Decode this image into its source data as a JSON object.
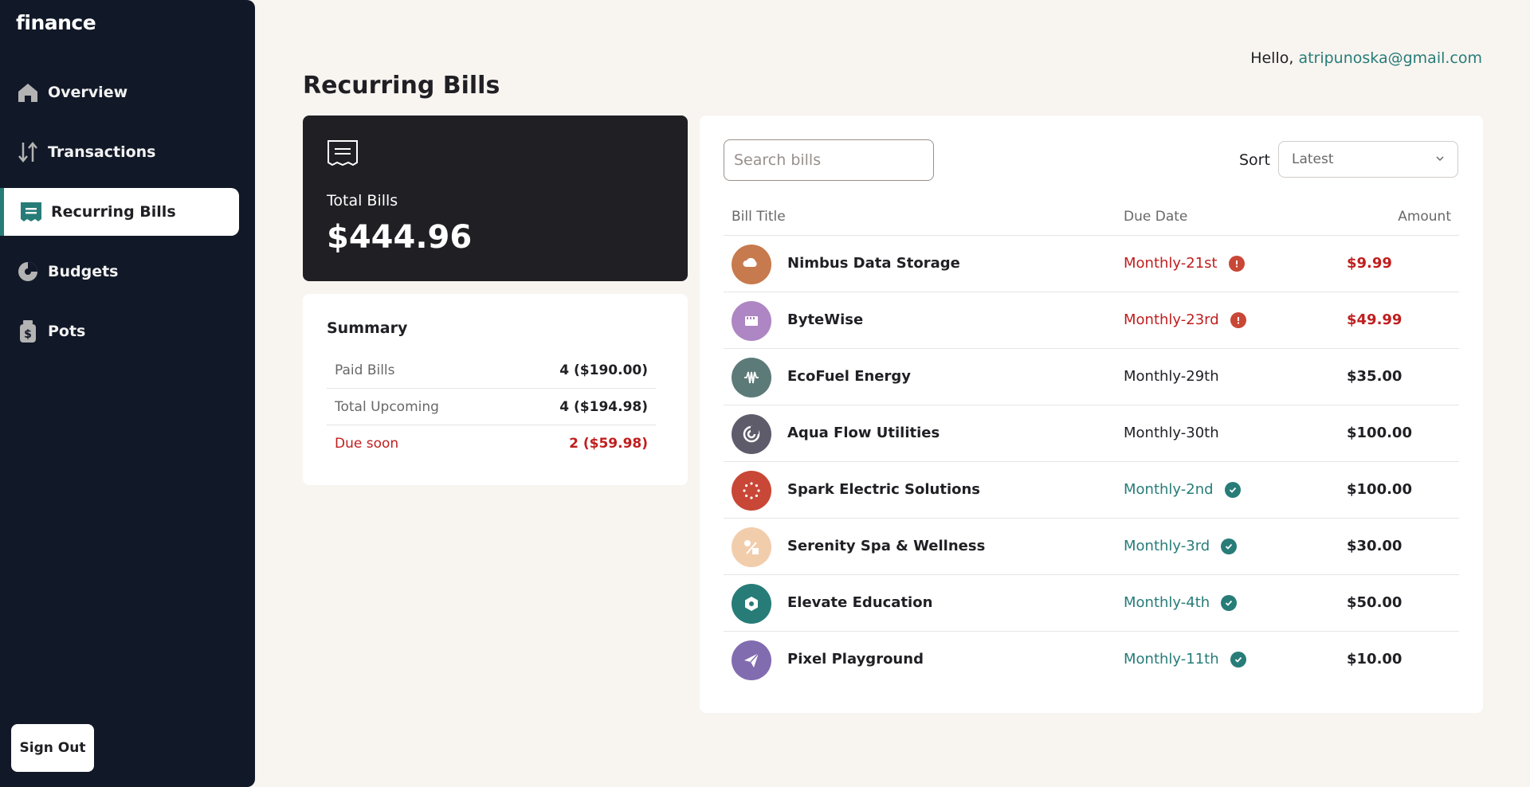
{
  "app": {
    "logo": "finance"
  },
  "nav": {
    "items": [
      {
        "label": "Overview",
        "icon": "home-icon"
      },
      {
        "label": "Transactions",
        "icon": "arrows-updown-icon"
      },
      {
        "label": "Recurring Bills",
        "icon": "receipt-icon",
        "active": true
      },
      {
        "label": "Budgets",
        "icon": "pie-icon"
      },
      {
        "label": "Pots",
        "icon": "jar-icon"
      }
    ],
    "signout": "Sign Out"
  },
  "header": {
    "greeting": "Hello, ",
    "email": "atripunoska@gmail.com"
  },
  "page": {
    "title": "Recurring Bills"
  },
  "total": {
    "label": "Total Bills",
    "value": "$444.96"
  },
  "summary": {
    "title": "Summary",
    "rows": [
      {
        "label": "Paid Bills",
        "value": "4 ($190.00)"
      },
      {
        "label": "Total Upcoming",
        "value": "4 ($194.98)"
      },
      {
        "label": "Due soon",
        "value": "2 ($59.98)"
      }
    ]
  },
  "bills": {
    "search_placeholder": "Search bills",
    "sort_label": "Sort",
    "sort_value": "Latest",
    "columns": {
      "title": "Bill Title",
      "due": "Due Date",
      "amount": "Amount"
    },
    "rows": [
      {
        "name": "Nimbus Data Storage",
        "due": "Monthly-21st",
        "amount": "$9.99",
        "status": "overdue",
        "color": "#c77a4d",
        "icon": "cloud-icon"
      },
      {
        "name": "ByteWise",
        "due": "Monthly-23rd",
        "amount": "$49.99",
        "status": "overdue",
        "color": "#ae86c3",
        "icon": "clapper-icon"
      },
      {
        "name": "EcoFuel Energy",
        "due": "Monthly-29th",
        "amount": "$35.00",
        "status": "upcoming",
        "color": "#5c7a78",
        "icon": "wave-icon"
      },
      {
        "name": "Aqua Flow Utilities",
        "due": "Monthly-30th",
        "amount": "$100.00",
        "status": "upcoming",
        "color": "#5e5c6b",
        "icon": "swirl-icon"
      },
      {
        "name": "Spark Electric Solutions",
        "due": "Monthly-2nd",
        "amount": "$100.00",
        "status": "paid",
        "color": "#c94736",
        "icon": "dots-ring-icon"
      },
      {
        "name": "Serenity Spa & Wellness",
        "due": "Monthly-3rd",
        "amount": "$30.00",
        "status": "paid",
        "color": "#f2cdac",
        "icon": "shapes-icon"
      },
      {
        "name": "Elevate Education",
        "due": "Monthly-4th",
        "amount": "$50.00",
        "status": "paid",
        "color": "#277c78",
        "icon": "hexagon-icon"
      },
      {
        "name": "Pixel Playground",
        "due": "Monthly-11th",
        "amount": "$10.00",
        "status": "paid",
        "color": "#826cb0",
        "icon": "paper-plane-icon"
      }
    ]
  }
}
